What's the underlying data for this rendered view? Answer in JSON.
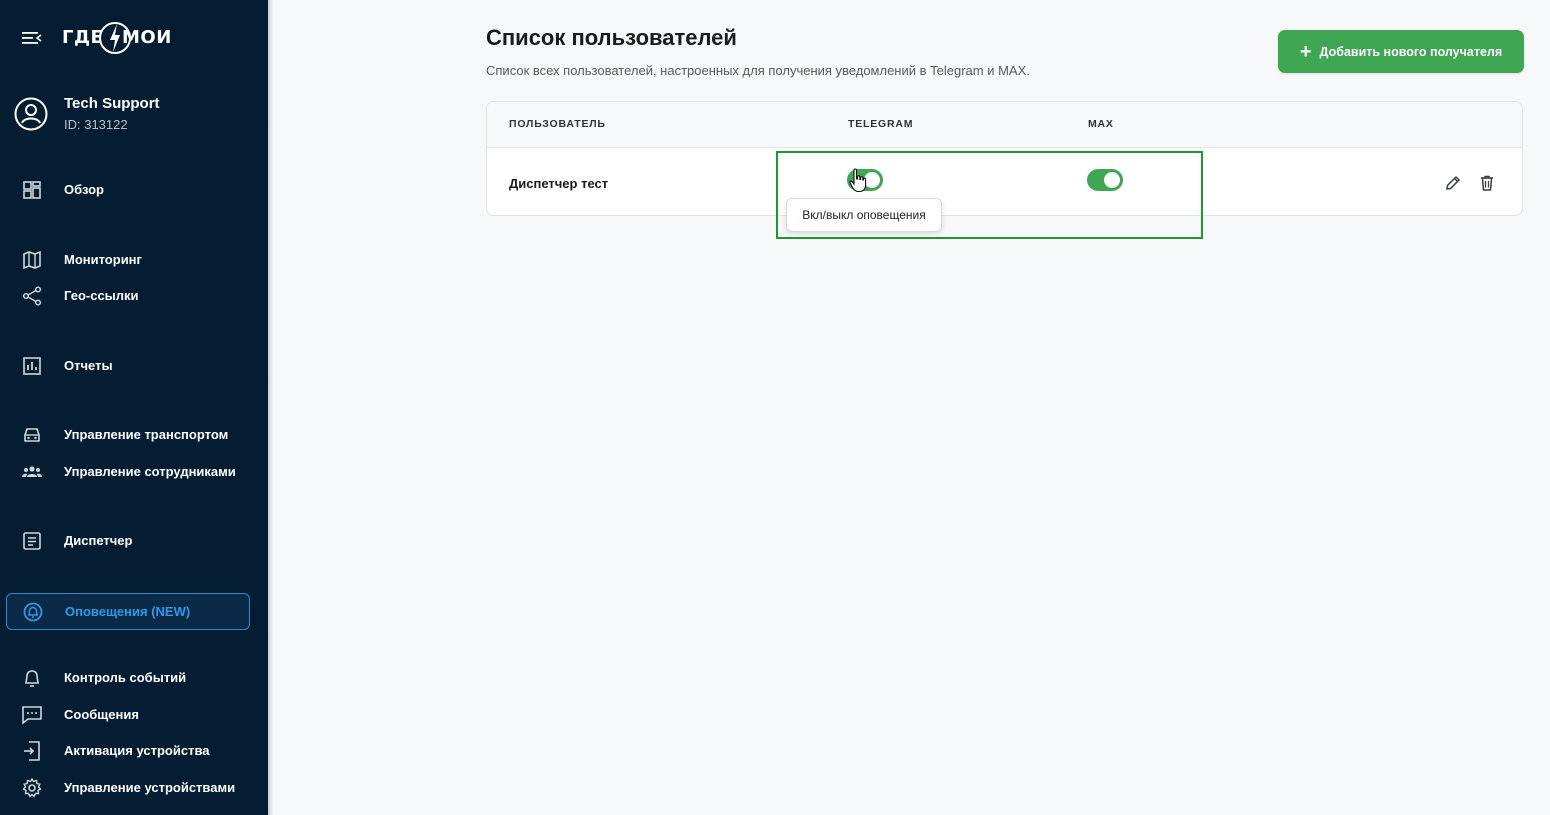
{
  "brand": {
    "logo_text_left": "ГДЕ",
    "logo_text_right": "МОИ",
    "accent": "#3fa752",
    "sidebar_bg": "#051d33",
    "active_nav": "#2d9ae6"
  },
  "user": {
    "name": "Tech Support",
    "id": "ID: 313122",
    "icon": "user-circle-icon"
  },
  "sidebar": {
    "items": [
      {
        "label": "Обзор",
        "icon": "dashboard-icon"
      },
      {
        "label": "Мониторинг",
        "icon": "map-icon"
      },
      {
        "label": "Гео-ссылки",
        "icon": "share-icon"
      },
      {
        "label": "Отчеты",
        "icon": "report-icon"
      },
      {
        "label": "Управление транспортом",
        "icon": "car-icon"
      },
      {
        "label": "Управление сотрудниками",
        "icon": "group-icon"
      },
      {
        "label": "Диспетчер",
        "icon": "document-icon"
      },
      {
        "label": "Оповещения (NEW)",
        "icon": "alert-icon",
        "active": true
      },
      {
        "label": "Контроль событий",
        "icon": "bell-icon"
      },
      {
        "label": "Сообщения",
        "icon": "message-icon"
      },
      {
        "label": "Активация устройства",
        "icon": "login-icon"
      },
      {
        "label": "Управление устройствами",
        "icon": "gear-icon"
      }
    ]
  },
  "main": {
    "title": "Список пользователей",
    "subtitle": "Список всех пользователей, настроенных для получения уведомлений в Telegram и MAX.",
    "add_button": {
      "label": "Добавить нового получателя",
      "icon": "plus-icon"
    },
    "table": {
      "columns": [
        "ПОЛЬЗОВАТЕЛЬ",
        "TELEGRAM",
        "MAX"
      ],
      "rows": [
        {
          "name": "Диспетчер тест",
          "telegram": true,
          "max": true
        }
      ]
    },
    "tooltip": "Вкл/выкл оповещения"
  }
}
